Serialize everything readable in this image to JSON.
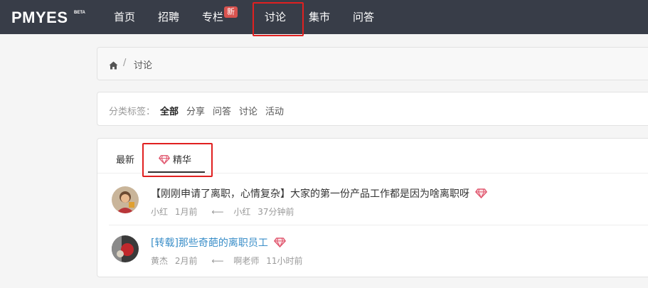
{
  "header": {
    "logo": "PMYES",
    "logo_badge": "BETA",
    "nav": [
      {
        "label": "首页"
      },
      {
        "label": "招聘"
      },
      {
        "label": "专栏"
      },
      {
        "label": "讨论"
      },
      {
        "label": "集市"
      },
      {
        "label": "问答"
      }
    ],
    "new_badge": "新"
  },
  "breadcrumb": {
    "home_icon": "home-icon",
    "separator": "/",
    "current": "讨论"
  },
  "filter": {
    "label": "分类标签：",
    "tags": [
      "全部",
      "分享",
      "问答",
      "讨论",
      "活动"
    ],
    "active": "全部"
  },
  "tabs": {
    "items": [
      {
        "label": "最新"
      },
      {
        "label": "精华",
        "icon": "diamond-icon"
      }
    ],
    "active": "精华"
  },
  "posts": [
    {
      "title": "【刚刚申请了离职，心情复杂】大家的第一份产品工作都是因为啥离职呀",
      "author": "小红",
      "time": "1月前",
      "arrow": "⟵",
      "last_reply_user": "小红",
      "last_reply_time": "37分钟前",
      "featured_icon": "diamond-icon"
    },
    {
      "title": "[转载]那些奇葩的离职员工",
      "author": "黄杰",
      "time": "2月前",
      "arrow": "⟵",
      "last_reply_user": "啊老师",
      "last_reply_time": "11小时前",
      "featured_icon": "diamond-icon"
    }
  ],
  "colors": {
    "topbar": "#383d48",
    "highlight_box": "#e02020",
    "badge": "#d9534f",
    "link": "#3a8ec8",
    "diamond": "#e0546c"
  }
}
